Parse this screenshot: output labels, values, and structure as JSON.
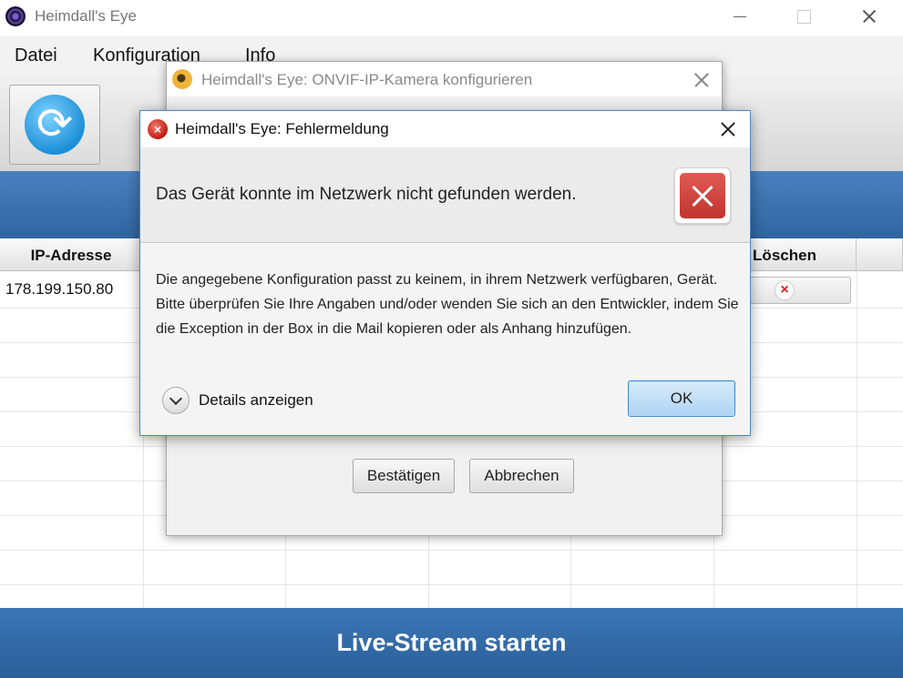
{
  "main_window": {
    "title": "Heimdall's Eye",
    "menu": [
      "Datei",
      "Konfiguration",
      "Info"
    ],
    "table": {
      "columns": [
        "IP-Adresse",
        "Löschen"
      ],
      "rows": [
        {
          "ip": "178.199.150.80"
        }
      ]
    },
    "live_stream_button": "Live-Stream starten",
    "colors": {
      "accent_blue": "#2f659f"
    }
  },
  "onvif_dialog": {
    "title": "Heimdall's Eye: ONVIF-IP-Kamera konfigurieren",
    "confirm_label": "Bestätigen",
    "cancel_label": "Abbrechen"
  },
  "error_dialog": {
    "title": "Heimdall's Eye: Fehlermeldung",
    "headline": "Das Gerät konnte im Netzwerk nicht gefunden werden.",
    "message": "Die angegebene Konfiguration passt zu keinem, in ihrem Netzwerk verfügbaren, Gerät. Bitte überprüfen Sie Ihre Angaben und/oder wenden Sie sich an den Entwickler, indem Sie die Exception in der Box in die Mail kopieren oder als Anhang hinzufügen.",
    "details_label": "Details anzeigen",
    "ok_label": "OK",
    "icons": {
      "title": "error-icon",
      "header": "error-x-icon",
      "details": "chevron-down-icon"
    },
    "colors": {
      "error_red": "#c8403a",
      "ok_button": "#aed3f2"
    }
  }
}
